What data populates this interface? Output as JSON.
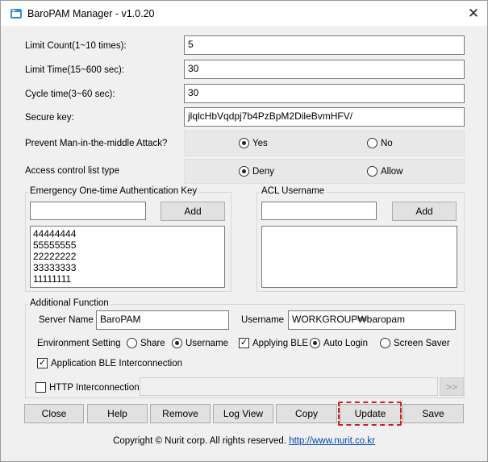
{
  "window": {
    "title": "BaroPAM Manager - v1.0.20",
    "close_label": "✕",
    "app_icon": "app-window-icon"
  },
  "fields": {
    "limit_count": {
      "label": "Limit Count(1~10 times):",
      "value": "5"
    },
    "limit_time": {
      "label": "Limit Time(15~600 sec):",
      "value": "30"
    },
    "cycle_time": {
      "label": "Cycle time(3~60 sec):",
      "value": "30"
    },
    "secure_key": {
      "label": "Secure key:",
      "value": "jlqlcHbVqdpj7b4PzBpM2DileBvmHFV/"
    }
  },
  "mitm": {
    "label": "Prevent Man-in-the-middle Attack?",
    "yes": "Yes",
    "no": "No",
    "selected": "Yes"
  },
  "acl_type": {
    "label": "Access control list type",
    "deny": "Deny",
    "allow": "Allow",
    "selected": "Deny"
  },
  "emergency": {
    "title": "Emergency One-time Authentication Key",
    "input_value": "",
    "add_label": "Add",
    "items": [
      "44444444",
      "55555555",
      "22222222",
      "33333333",
      "11111111"
    ]
  },
  "acl_username": {
    "title": "ACL Username",
    "input_value": "",
    "add_label": "Add",
    "items": []
  },
  "additional": {
    "title": "Additional Function",
    "server_name_label": "Server Name",
    "server_name_value": "BaroPAM",
    "username_label": "Username",
    "username_value": "WORKGROUP₩baropam",
    "env_label": "Environment Setting",
    "share": "Share",
    "username_radio": "Username",
    "env_selected": "Username",
    "applying_ble": "Applying BLE",
    "applying_ble_checked": true,
    "auto_login": "Auto Login",
    "screen_saver": "Screen Saver",
    "login_mode_selected": "Auto Login",
    "app_ble": "Application BLE Interconnection",
    "app_ble_checked": true,
    "http": "HTTP Interconnection",
    "http_checked": false,
    "http_value": "",
    "more_label": ">>"
  },
  "buttons": [
    "Close",
    "Help",
    "Remove",
    "Log View",
    "Copy",
    "Update",
    "Save"
  ],
  "footer": {
    "copyright": "Copyright © Nurit corp. All rights reserved.",
    "link": "http://www.nurit.co.kr"
  },
  "colors": {
    "highlight": "#d21e1e",
    "link": "#0645ad"
  }
}
